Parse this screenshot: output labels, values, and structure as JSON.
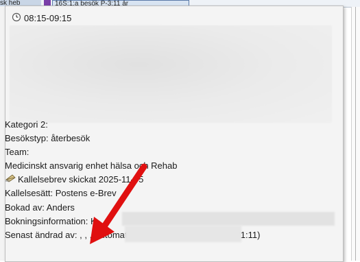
{
  "background": {
    "tab_a_label": "sk heb",
    "tab_c_label": "16S:1:a besök P-3:11 år"
  },
  "tooltip": {
    "time_range": "08:15-09:15",
    "lines": [
      "Kategori 2:",
      "Besökstyp: återbesök",
      "Team:",
      "Medicinskt ansvarig enhet hälsa och Rehab",
      "Kallelsebrev skickat 2025-11-05",
      "Kallelsesätt: Postens e-Brev",
      "Bokad av: Anders",
      "Bokningsinformation: K",
      "Senast ändrad av: , , , Automatstangdkontakt (2026-01-11 21:11)"
    ]
  },
  "icons": {
    "clock": "clock-icon",
    "envelope": "envelope-icon",
    "annotation_arrow": "red-arrow-icon"
  },
  "colors": {
    "arrow": "#e01010",
    "tooltip_bg": "#f4f4f4"
  }
}
